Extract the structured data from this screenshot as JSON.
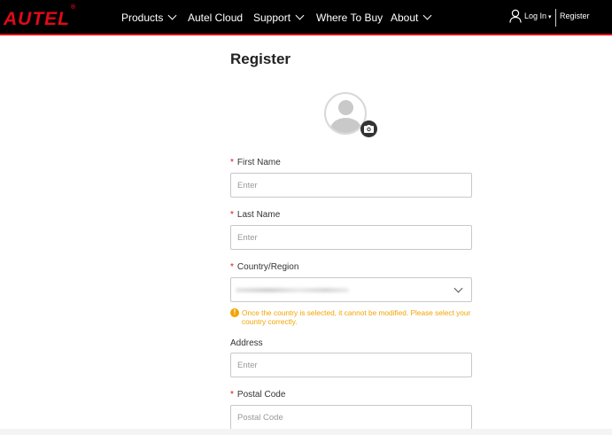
{
  "brand": {
    "logo_text": "AUTEL",
    "trademark": "®",
    "accent_color": "#e10a17"
  },
  "nav": {
    "items": [
      {
        "label": "Products",
        "has_dropdown": true
      },
      {
        "label": "Autel Cloud",
        "has_dropdown": false
      },
      {
        "label": "Support",
        "has_dropdown": true
      },
      {
        "label": "Where To Buy",
        "has_dropdown": false
      },
      {
        "label": "About",
        "has_dropdown": true
      }
    ],
    "login_label": "Log In",
    "login_caret": "▾",
    "register_label": "Register",
    "user_icon": "user-icon"
  },
  "page": {
    "title": "Register"
  },
  "avatar": {
    "icon": "avatar-placeholder-icon",
    "upload_icon": "camera-icon"
  },
  "form": {
    "required_mark": "*",
    "first_name": {
      "label": "First Name",
      "placeholder": "Enter",
      "value": "",
      "required": true
    },
    "last_name": {
      "label": "Last Name",
      "placeholder": "Enter",
      "value": "",
      "required": true
    },
    "country": {
      "label": "Country/Region",
      "required": true,
      "value_obscured": true,
      "warning_icon": "!",
      "warning": "Once the country is selected, it cannot be modified. Please select your country correctly."
    },
    "address": {
      "label": "Address",
      "placeholder": "Enter",
      "value": "",
      "required": false
    },
    "postal_code": {
      "label": "Postal Code",
      "placeholder": "Postal Code",
      "value": "",
      "required": true
    }
  },
  "colors": {
    "nav_bg": "#000000",
    "warning": "#f2a400",
    "required": "#e10a17"
  }
}
